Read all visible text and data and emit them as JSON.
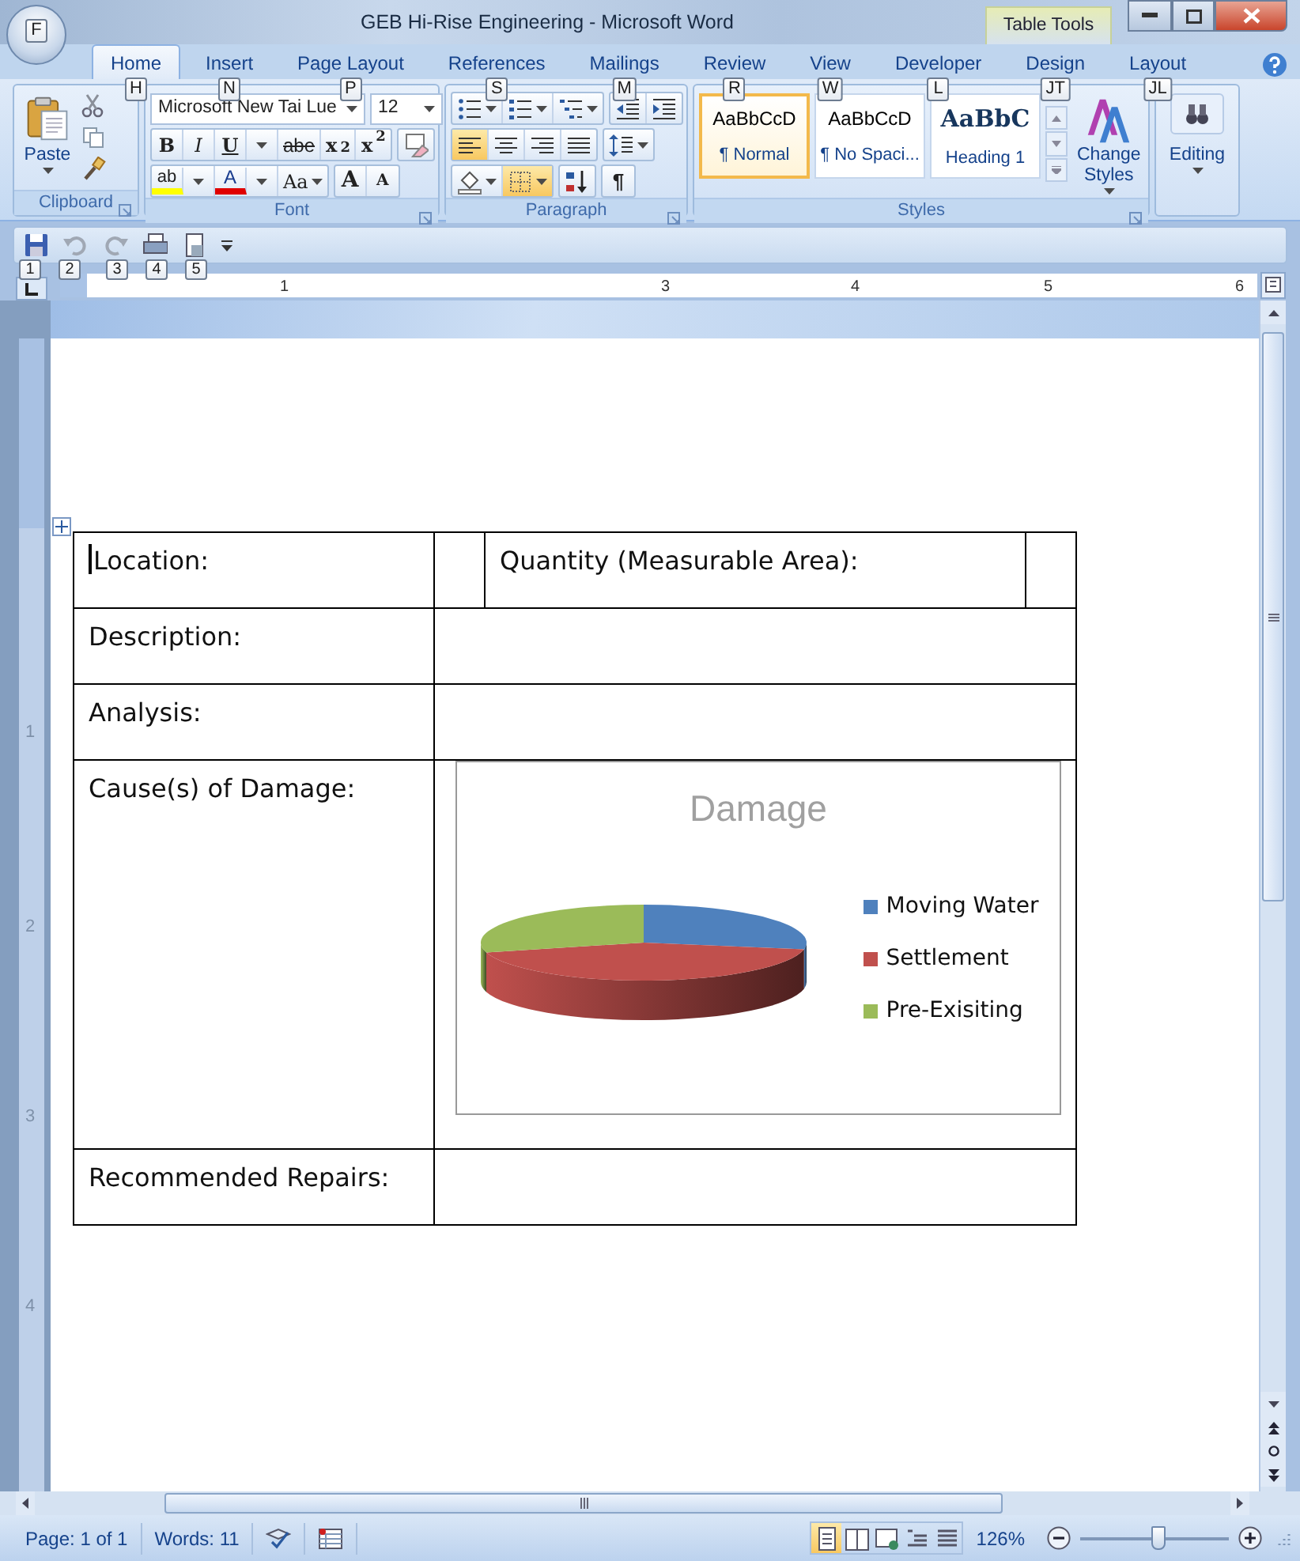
{
  "window": {
    "title": "GEB Hi-Rise Engineering - Microsoft Word",
    "context_label": "Table Tools",
    "office_keytip": "F"
  },
  "tabs": [
    {
      "label": "Home",
      "keytip": "H",
      "selected": true
    },
    {
      "label": "Insert",
      "keytip": "N",
      "selected": false
    },
    {
      "label": "Page Layout",
      "keytip": "P",
      "selected": false
    },
    {
      "label": "References",
      "keytip": "S",
      "selected": false
    },
    {
      "label": "Mailings",
      "keytip": "M",
      "selected": false
    },
    {
      "label": "Review",
      "keytip": "R",
      "selected": false
    },
    {
      "label": "View",
      "keytip": "W",
      "selected": false
    },
    {
      "label": "Developer",
      "keytip": "L",
      "selected": false
    },
    {
      "label": "Design",
      "keytip": "JT",
      "selected": false
    },
    {
      "label": "Layout",
      "keytip": "JL",
      "selected": false
    }
  ],
  "clipboard": {
    "label": "Clipboard",
    "paste": "Paste"
  },
  "font": {
    "label": "Font",
    "name": "Microsoft New Tai Lue",
    "size": "12",
    "format_buttons": [
      {
        "text": "B",
        "kind": "bold"
      },
      {
        "text": "I",
        "kind": "italic"
      },
      {
        "text": "U",
        "kind": "underline"
      },
      {
        "text": "abe",
        "kind": "strike"
      },
      {
        "text": "x$_{2}$",
        "kind": "sub"
      },
      {
        "text": "x$^{2}$",
        "kind": "sup"
      }
    ],
    "highlight": "ab",
    "font_color": "A",
    "change_case": "Aa",
    "grow": "A",
    "shrink": "A"
  },
  "paragraph": {
    "label": "Paragraph",
    "alignments": [
      {
        "kind": "left",
        "selected": true
      },
      {
        "kind": "center",
        "selected": false
      },
      {
        "kind": "right",
        "selected": false
      },
      {
        "kind": "justify",
        "selected": false
      }
    ],
    "borders_selected": true,
    "pilcrow": "¶"
  },
  "styles": {
    "label": "Styles",
    "items": [
      {
        "preview": "AaBbCcD",
        "name": "¶ Normal",
        "kind": "body",
        "selected": true
      },
      {
        "preview": "AaBbCcD",
        "name": "¶ No Spaci...",
        "kind": "body",
        "selected": false
      },
      {
        "preview": "AaBbC",
        "name": "Heading 1",
        "kind": "heading",
        "selected": false
      }
    ],
    "change_styles": "Change Styles"
  },
  "editing": {
    "label": "Editing"
  },
  "quick_access": {
    "keytips": [
      "1",
      "2",
      "3",
      "4",
      "5"
    ]
  },
  "ruler": {
    "labels": [
      "1",
      "3",
      "4",
      "5",
      "6"
    ]
  },
  "vertical_ruler": {
    "labels": [
      "1",
      "2",
      "3",
      "4"
    ]
  },
  "table": {
    "rows": [
      {
        "kind": "split",
        "label": "Location:",
        "second_label": "Quantity (Measurable Area):"
      },
      {
        "kind": "plain",
        "label": "Description:"
      },
      {
        "kind": "plain",
        "label": "Analysis:"
      },
      {
        "kind": "chart",
        "label": "Cause(s) of Damage:",
        "chart": {
          "title": "Damage",
          "legend": [
            {
              "name": "Moving Water",
              "color": "#4f81bd"
            },
            {
              "name": "Settlement",
              "color": "#c0504d"
            },
            {
              "name": "Pre-Exisiting",
              "color": "#9bbb59"
            }
          ]
        }
      },
      {
        "kind": "plain",
        "label": "Recommended Repairs:"
      }
    ]
  },
  "status_bar": {
    "page": "Page: 1 of 1",
    "words": "Words: 11",
    "views": [
      {
        "selected": true
      },
      {
        "selected": false
      },
      {
        "selected": false
      },
      {
        "selected": false
      },
      {
        "selected": false
      }
    ],
    "zoom": "126%",
    "zoom_slider": {
      "level": 0.52
    }
  }
}
